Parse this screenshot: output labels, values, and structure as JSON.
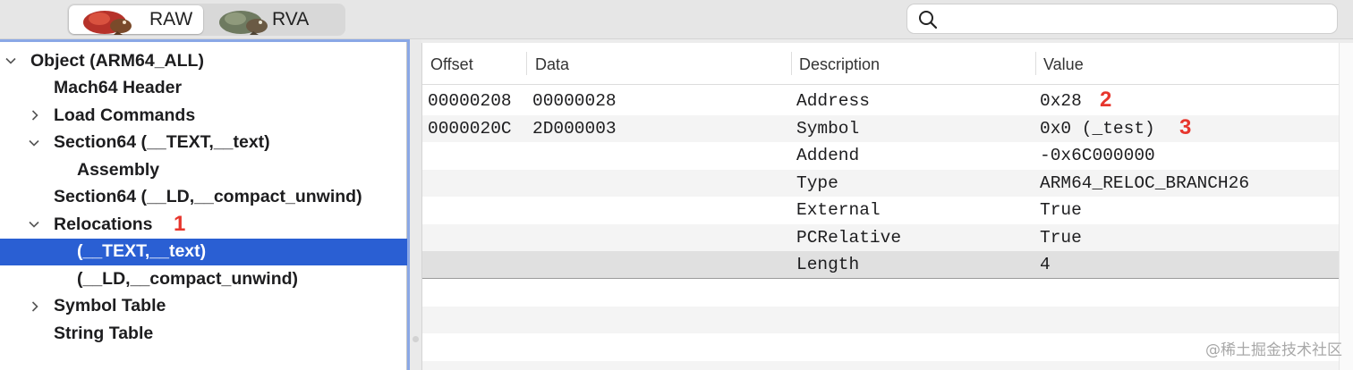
{
  "toolbar": {
    "segments": [
      {
        "label": "RAW",
        "selected": true,
        "mascot": "ruby-bird-mascot"
      },
      {
        "label": "RVA",
        "selected": false,
        "mascot": "green-bird-mascot"
      }
    ],
    "search": {
      "value": "",
      "placeholder": "",
      "icon": "search-icon"
    }
  },
  "sidebar": {
    "items": [
      {
        "label": "Object  (ARM64_ALL)",
        "expanded": true,
        "chevron": "chevron-down-icon",
        "annotation": ""
      },
      {
        "label": "Mach64 Header",
        "annotation": ""
      },
      {
        "label": "Load Commands",
        "expanded": false,
        "chevron": "chevron-right-icon",
        "annotation": ""
      },
      {
        "label": "Section64 (__TEXT,__text)",
        "expanded": true,
        "chevron": "chevron-down-icon",
        "annotation": ""
      },
      {
        "label": "Assembly",
        "annotation": ""
      },
      {
        "label": "Section64 (__LD,__compact_unwind)",
        "annotation": ""
      },
      {
        "label": "Relocations",
        "expanded": true,
        "chevron": "chevron-down-icon",
        "annotation": "1"
      },
      {
        "label": "(__TEXT,__text)",
        "selected": true,
        "annotation": ""
      },
      {
        "label": "(__LD,__compact_unwind)",
        "annotation": ""
      },
      {
        "label": "Symbol Table",
        "expanded": false,
        "chevron": "chevron-right-icon",
        "annotation": ""
      },
      {
        "label": "String Table",
        "annotation": ""
      }
    ]
  },
  "table": {
    "columns": [
      "Offset",
      "Data",
      "Description",
      "Value"
    ],
    "rows": [
      {
        "offset": "00000208",
        "data": "00000028",
        "description": "Address",
        "value": "0x28",
        "annotation": "2"
      },
      {
        "offset": "0000020C",
        "data": "2D000003",
        "description": "Symbol",
        "value": "0x0 (_test)",
        "annotation": "3"
      },
      {
        "offset": "",
        "data": "",
        "description": "Addend",
        "value": "-0x6C000000",
        "annotation": ""
      },
      {
        "offset": "",
        "data": "",
        "description": "Type",
        "value": "ARM64_RELOC_BRANCH26",
        "annotation": ""
      },
      {
        "offset": "",
        "data": "",
        "description": "External",
        "value": "True",
        "annotation": ""
      },
      {
        "offset": "",
        "data": "",
        "description": "PCRelative",
        "value": "True",
        "annotation": ""
      },
      {
        "offset": "",
        "data": "",
        "description": "Length",
        "value": "4",
        "annotation": ""
      }
    ]
  },
  "watermark": "@稀土掘金技术社区",
  "colors": {
    "selection": "#2a5fd3",
    "annotation": "#e7362d",
    "focus_ring": "#8aa8e6"
  }
}
